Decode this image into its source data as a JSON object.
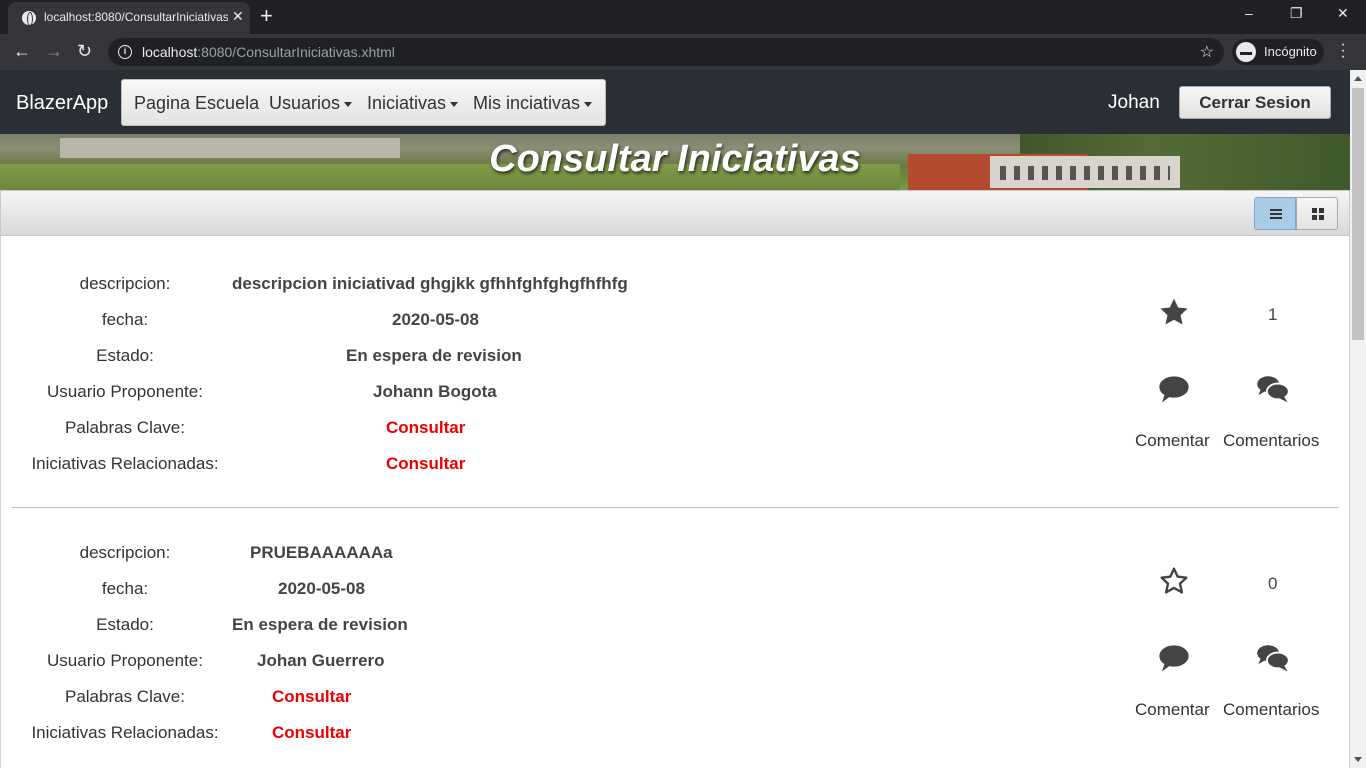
{
  "browser": {
    "tab_title": "localhost:8080/ConsultarIniciativas.xhtml",
    "new_tab": "+",
    "url_host": "localhost",
    "url_rest": ":8080/ConsultarIniciativas.xhtml",
    "incognito_label": "Incógnito",
    "minimize": "–",
    "maximize": "❐",
    "close": "✕",
    "back": "←",
    "forward": "→",
    "reload": "↻",
    "tab_close": "✕",
    "bookmark": "☆"
  },
  "navbar": {
    "brand": "BlazerApp",
    "menu": [
      {
        "label": "Pagina Escuela",
        "dropdown": false
      },
      {
        "label": "Usuarios",
        "dropdown": true
      },
      {
        "label": "Iniciativas",
        "dropdown": true
      },
      {
        "label": "Mis inciativas",
        "dropdown": true
      }
    ],
    "user": "Johan",
    "logout": "Cerrar Sesion"
  },
  "banner": {
    "title": "Consultar Iniciativas"
  },
  "view_toggle": {
    "active": "list",
    "icons": [
      "list-icon",
      "grid-icon"
    ]
  },
  "field_labels": {
    "descripcion": "descripcion:",
    "fecha": "fecha:",
    "estado": "Estado:",
    "usuario": "Usuario Proponente:",
    "palabras": "Palabras Clave:",
    "relacionadas": "Iniciativas Relacionadas:"
  },
  "actions": {
    "comment": "Comentar",
    "comments": "Comentarios",
    "link_color": "#e00000"
  },
  "initiatives": [
    {
      "descripcion": "descripcion iniciativad ghgjkk gfhhfghfghgfhfhfg",
      "fecha": "2020-05-08",
      "estado": "En espera de revision",
      "usuario": "Johann Bogota",
      "palabras": "Consultar",
      "relacionadas": "Consultar",
      "starred": true,
      "likes": "1"
    },
    {
      "descripcion": "PRUEBAAAAAAa",
      "fecha": "2020-05-08",
      "estado": "En espera de revision",
      "usuario": "Johan Guerrero",
      "palabras": "Consultar",
      "relacionadas": "Consultar",
      "starred": false,
      "likes": "0"
    }
  ]
}
